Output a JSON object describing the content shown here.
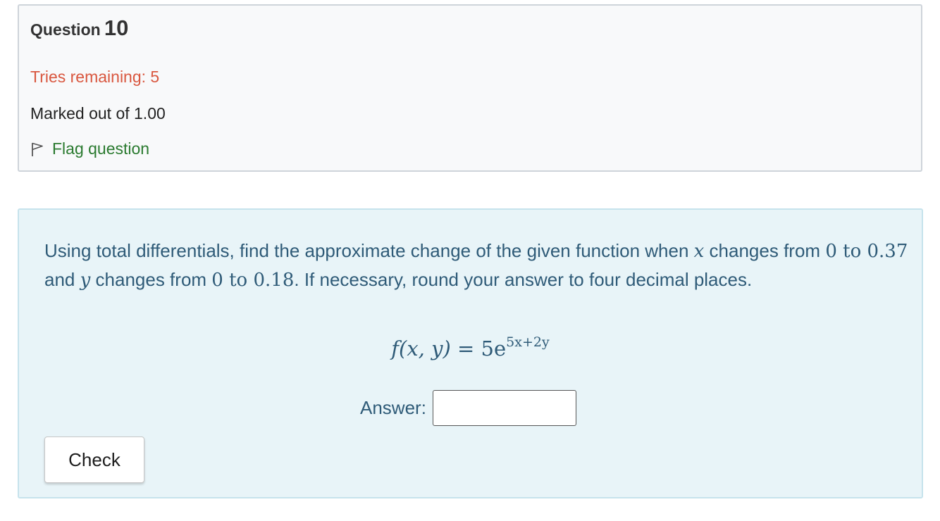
{
  "question": {
    "heading_word": "Question",
    "number": "10",
    "tries_remaining": "Tries remaining: 5",
    "marked_out_of": "Marked out of 1.00",
    "flag_label": "Flag question",
    "flag_icon": "flag-outline-icon"
  },
  "content": {
    "text": {
      "p1": "Using total differentials, find the approximate change of the given function when ",
      "var_x": "x",
      "p2": " changes from ",
      "x_from": "0",
      "to_1": " to ",
      "x_to": "0.37",
      "p3": " and ",
      "var_y": "y",
      "p4": " changes from ",
      "y_from": "0",
      "to_2": " to ",
      "y_to": "0.18",
      "p5": ". If necessary, round your answer to four decimal places."
    },
    "formula": {
      "f": "f",
      "args": "(x, y)",
      "equals": " = 5e",
      "exponent": "5x+2y"
    },
    "answer_label": "Answer:",
    "answer_value": "",
    "check_button": "Check"
  },
  "colors": {
    "tries": "#d9573f",
    "flag": "#2a7a2f",
    "question_text": "#2f5b78",
    "info_bg": "#f8f9fa",
    "content_bg": "#e8f4f8"
  }
}
